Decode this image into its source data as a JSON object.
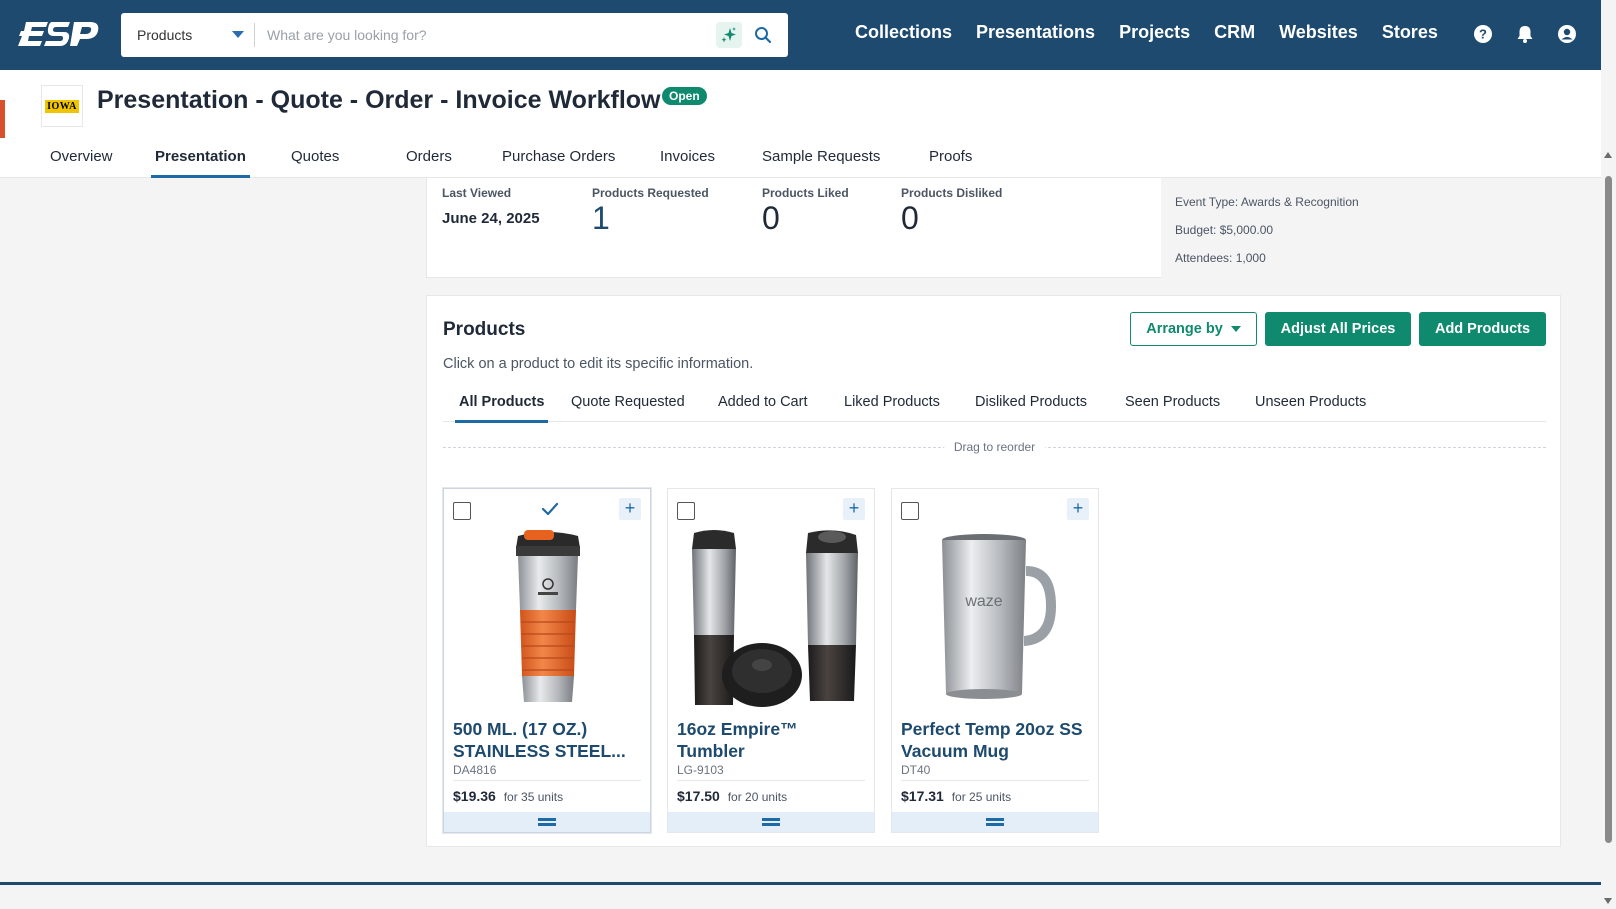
{
  "topbar": {
    "logo_text": "ESP",
    "search": {
      "category": "Products",
      "placeholder": "What are you looking for?",
      "value": ""
    },
    "nav": [
      "Collections",
      "Presentations",
      "Projects",
      "CRM",
      "Websites",
      "Stores"
    ],
    "icons": [
      "help-icon",
      "bell-icon",
      "user-account-icon"
    ]
  },
  "header": {
    "brand_logo_text": "IOWA",
    "title": "Presentation - Quote - Order - Invoice Workflow",
    "status": "Open",
    "tabs": [
      "Overview",
      "Presentation",
      "Quotes",
      "Orders",
      "Purchase Orders",
      "Invoices",
      "Sample Requests",
      "Proofs"
    ],
    "active_tab": "Presentation"
  },
  "stats": {
    "last_viewed_label": "Last Viewed",
    "last_viewed_value": "June 24, 2025",
    "requested_label": "Products Requested",
    "requested_value": "1",
    "liked_label": "Products Liked",
    "liked_value": "0",
    "disliked_label": "Products Disliked",
    "disliked_value": "0"
  },
  "event": {
    "type": "Event Type: Awards & Recognition",
    "budget": "Budget: $5,000.00",
    "attendees": "Attendees: 1,000"
  },
  "products": {
    "heading": "Products",
    "subtitle": "Click on a product to edit its specific information.",
    "arrange_label": "Arrange by",
    "adjust_label": "Adjust All Prices",
    "add_label": "Add Products",
    "tabs": [
      "All Products",
      "Quote Requested",
      "Added to Cart",
      "Liked Products",
      "Disliked Products",
      "Seen Products",
      "Unseen Products"
    ],
    "active_tab": "All Products",
    "reorder_hint": "Drag to reorder",
    "items": [
      {
        "name": "500 ML. (17 OZ.) STAINLESS STEEL...",
        "sku": "DA4816",
        "price": "$19.36",
        "qty": "for 35 units",
        "quote_requested": true,
        "image": "orange-travel-tumbler"
      },
      {
        "name": "16oz Empire™ Tumbler",
        "sku": "LG-9103",
        "price": "$17.50",
        "qty": "for 20 units",
        "quote_requested": false,
        "image": "steel-black-tumblers"
      },
      {
        "name": "Perfect Temp 20oz SS Vacuum Mug",
        "sku": "DT40",
        "price": "$17.31",
        "qty": "for 25 units",
        "quote_requested": false,
        "image": "steel-mug-waze"
      }
    ]
  },
  "colors": {
    "topbar": "#1d4a6e",
    "accent_green": "#108a6e",
    "accent_blue": "#1d6aa5",
    "brand_red": "#d9512c"
  }
}
